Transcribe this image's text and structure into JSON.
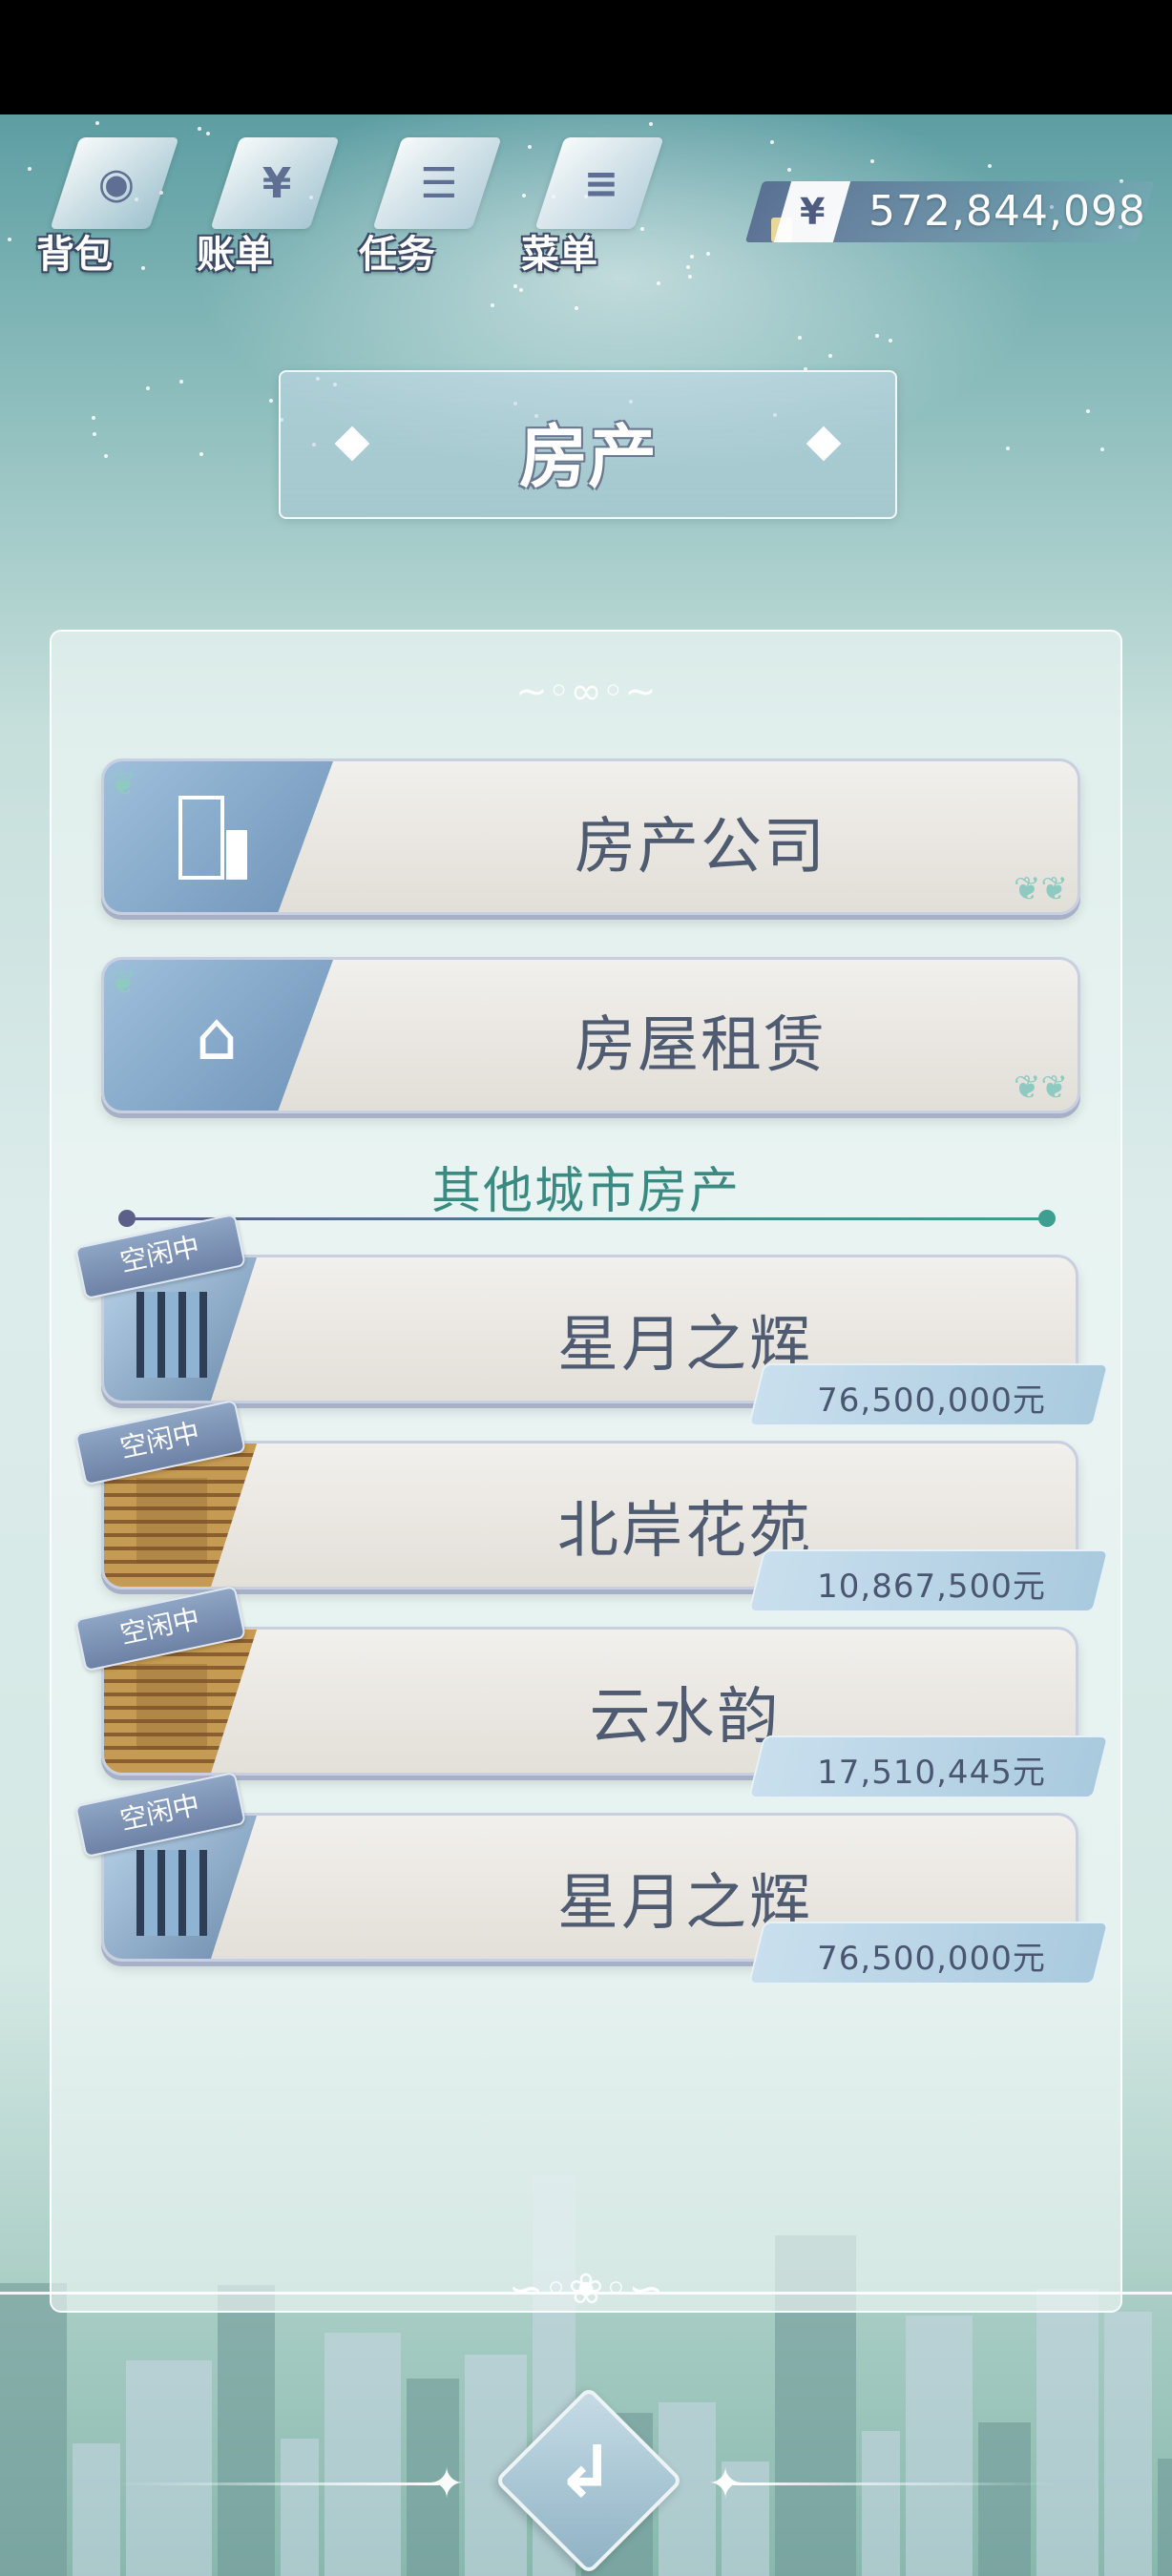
{
  "topmenu": {
    "items": [
      {
        "label": "背包",
        "icon": "bag-icon",
        "glyph": "◉"
      },
      {
        "label": "账单",
        "icon": "bill-icon",
        "glyph": "¥"
      },
      {
        "label": "任务",
        "icon": "task-icon",
        "glyph": "☰"
      },
      {
        "label": "菜单",
        "icon": "menu-icon",
        "glyph": "≡"
      }
    ]
  },
  "money": {
    "symbol": "¥",
    "value": "572,844,098"
  },
  "page_title": "房产",
  "main_buttons": [
    {
      "label": "房产公司",
      "icon": "building-icon"
    },
    {
      "label": "房屋租赁",
      "icon": "house-search-icon"
    }
  ],
  "section": {
    "title": "其他城市房产"
  },
  "properties": [
    {
      "status": "空闲中",
      "name": "星月之辉",
      "price": "76,500,000元",
      "image": "glass-villa"
    },
    {
      "status": "空闲中",
      "name": "北岸花苑",
      "price": "10,867,500元",
      "image": "brick-apartment"
    },
    {
      "status": "空闲中",
      "name": "云水韵",
      "price": "17,510,445元",
      "image": "brick-apartment"
    },
    {
      "status": "空闲中",
      "name": "星月之辉",
      "price": "76,500,000元",
      "image": "glass-villa"
    }
  ],
  "back_button": {
    "glyph": "↲",
    "icon": "back-arrow-icon"
  },
  "colors": {
    "accent_teal": "#3b8a82",
    "button_text": "#4f5b70",
    "tag_blue": "#7a8fb2"
  }
}
